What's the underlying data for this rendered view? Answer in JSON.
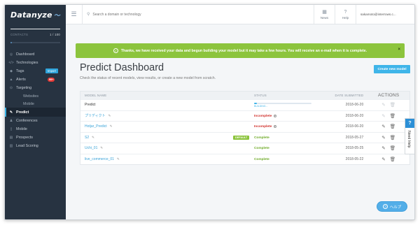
{
  "sidebar": {
    "logo": "Datanyze",
    "contacts_label": "CONTACTS",
    "contacts_count": "1 / 100",
    "contacts_fraction": 0.01,
    "items": [
      {
        "label": "Dashboard",
        "icon": "dashboard-icon"
      },
      {
        "label": "Technologies",
        "icon": "code-icon"
      },
      {
        "label": "Tags",
        "icon": "tag-icon",
        "badge": "Import"
      },
      {
        "label": "Alerts",
        "icon": "bell-icon",
        "badge": "99+"
      },
      {
        "label": "Targeting",
        "icon": "target-icon"
      },
      {
        "label": "Websites",
        "sub": true
      },
      {
        "label": "Mobile",
        "sub": true
      },
      {
        "label": "Predict",
        "icon": "predict-icon",
        "active": true
      },
      {
        "label": "Conferences",
        "icon": "conference-icon"
      },
      {
        "label": "Mobile",
        "icon": "mobile-icon"
      },
      {
        "label": "Prospects",
        "icon": "prospects-icon"
      },
      {
        "label": "Lead Scoring",
        "icon": "lead-scoring-icon"
      }
    ]
  },
  "topbar": {
    "search_placeholder": "Search a domain or technology",
    "news_label": "News",
    "help_label": "Help",
    "account": "sakamoto@interrows.c..."
  },
  "alert": {
    "message": "Thanks, we have received your data and begun building your model but it may take a few hours. You will receive an e-mail when it is complete.",
    "close": "×",
    "color": "#8cc43d"
  },
  "page": {
    "title": "Predict Dashboard",
    "subtitle": "Check the status of recent models, view results, or create a new model from scratch.",
    "create_button": "Create new model"
  },
  "table": {
    "headers": {
      "name": "MODEL NAME",
      "status": "STATUS",
      "date": "DATE SUBMITTED",
      "actions": "ACTIONS"
    },
    "rows": [
      {
        "name": "Predict",
        "status": "BUILDING...",
        "status_type": "building",
        "progress": 0.05,
        "date": "2018-06-20",
        "link": false
      },
      {
        "name": "プリディクト",
        "status": "Incomplete",
        "status_type": "incomplete",
        "date": "2018-06-20",
        "link": true
      },
      {
        "name": "Hotjar_Predict",
        "status": "Incomplete",
        "status_type": "incomplete",
        "date": "2018-06-20",
        "link": true
      },
      {
        "name": "S2",
        "status": "Complete",
        "status_type": "complete",
        "date": "2018-05-27",
        "link": true,
        "badge": "DEFAULT"
      },
      {
        "name": "Uchi_01",
        "status": "Complete",
        "status_type": "complete",
        "date": "2018-05-25",
        "link": true
      },
      {
        "name": "live_commerce_01",
        "status": "Complete",
        "status_type": "complete",
        "date": "2018-05-22",
        "link": true
      }
    ]
  },
  "need_help": "Need Help",
  "help_button": "ヘルプ",
  "colors": {
    "sidebar": "#273341",
    "accent": "#3fb5e9",
    "complete": "#6fab2a",
    "incomplete": "#d0312d"
  }
}
